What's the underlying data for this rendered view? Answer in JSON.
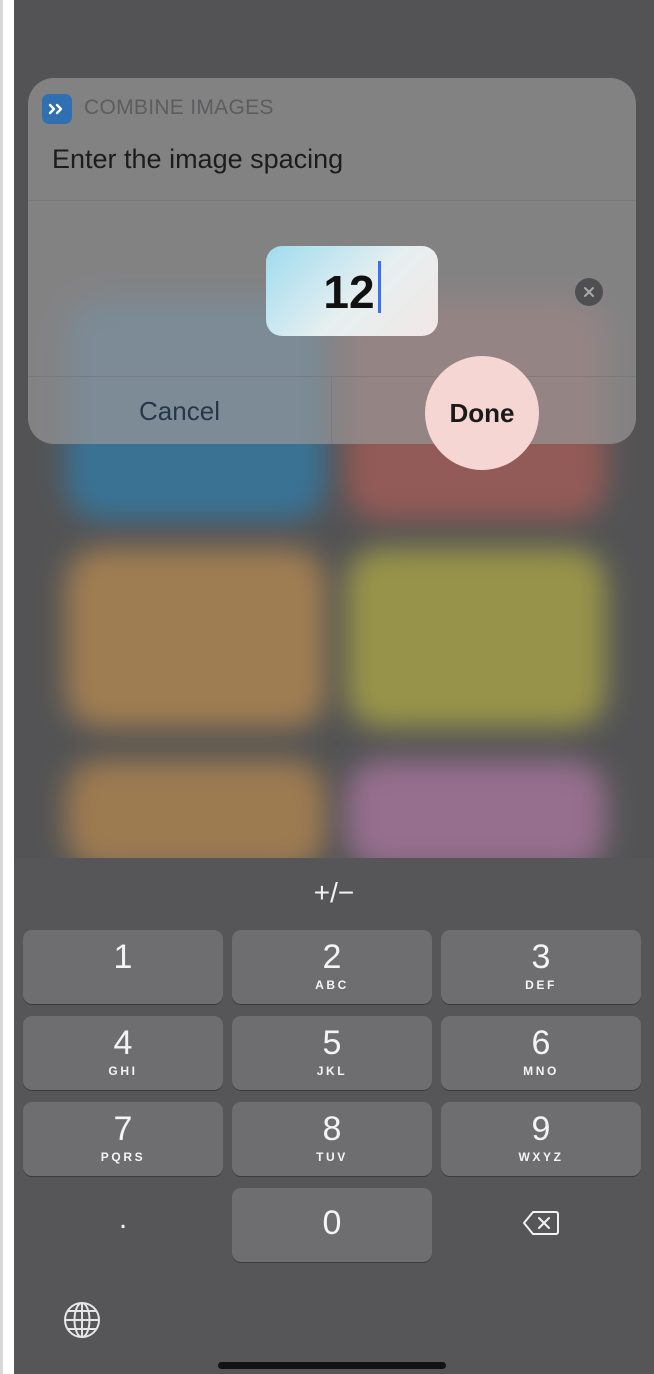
{
  "dialog": {
    "app_name": "COMBINE IMAGES",
    "prompt": "Enter the image spacing",
    "value": "12",
    "cancel_label": "Cancel",
    "done_label": "Done"
  },
  "keyboard": {
    "plusminus_label": "+/−",
    "keys": [
      {
        "digit": "1",
        "letters": ""
      },
      {
        "digit": "2",
        "letters": "ABC"
      },
      {
        "digit": "3",
        "letters": "DEF"
      },
      {
        "digit": "4",
        "letters": "GHI"
      },
      {
        "digit": "5",
        "letters": "JKL"
      },
      {
        "digit": "6",
        "letters": "MNO"
      },
      {
        "digit": "7",
        "letters": "PQRS"
      },
      {
        "digit": "8",
        "letters": "TUV"
      },
      {
        "digit": "9",
        "letters": "WXYZ"
      },
      {
        "digit": "0",
        "letters": ""
      }
    ],
    "decimal_label": "."
  },
  "icons": {
    "app": "shortcuts-app-icon",
    "clear": "clear-text-icon",
    "delete": "backspace-icon",
    "globe": "globe-icon"
  },
  "colors": {
    "app_badge": "#2f6fb2",
    "done_highlight": "#f6d6d2",
    "caret": "#3a6ff7"
  }
}
